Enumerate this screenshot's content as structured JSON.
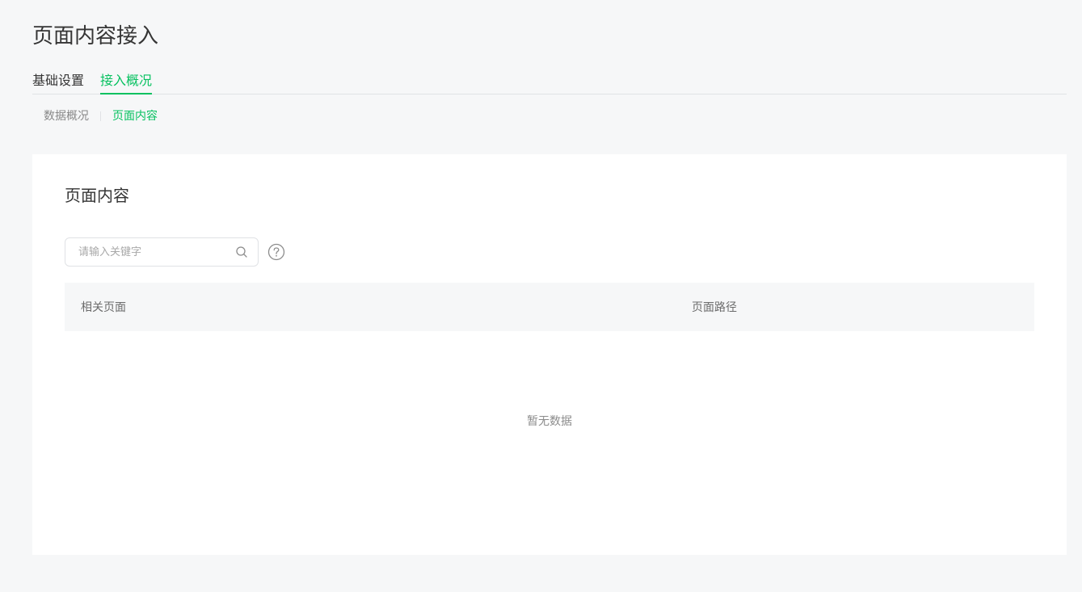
{
  "page": {
    "title": "页面内容接入"
  },
  "main_tabs": [
    {
      "label": "基础设置",
      "active": false
    },
    {
      "label": "接入概况",
      "active": true
    }
  ],
  "sub_tabs": [
    {
      "label": "数据概况",
      "active": false
    },
    {
      "label": "页面内容",
      "active": true
    }
  ],
  "card": {
    "title": "页面内容",
    "search": {
      "placeholder": "请输入关键字",
      "value": ""
    },
    "table": {
      "columns": [
        "相关页面",
        "页面路径"
      ],
      "empty_text": "暂无数据"
    }
  },
  "icons": {
    "search": "search-icon",
    "help": "question-circle-icon"
  },
  "colors": {
    "accent": "#07c160",
    "background": "#f6f7f8"
  }
}
